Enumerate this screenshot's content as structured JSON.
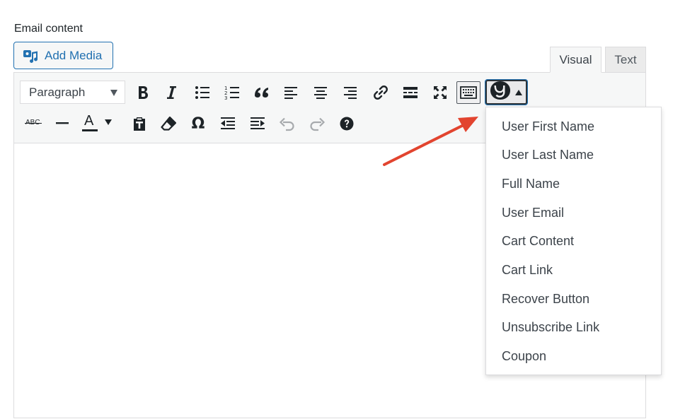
{
  "section": {
    "label": "Email content"
  },
  "media": {
    "add_label": "Add Media"
  },
  "tabs": {
    "visual": "Visual",
    "text": "Text"
  },
  "toolbar": {
    "format_value": "Paragraph",
    "row1_icons": [
      "bold-icon",
      "italic-icon",
      "bulleted-list-icon",
      "numbered-list-icon",
      "blockquote-icon",
      "align-left-icon",
      "align-center-icon",
      "align-right-icon",
      "link-icon",
      "read-more-icon",
      "fullscreen-icon",
      "toolbar-toggle-icon"
    ],
    "row2_icons": [
      "strikethrough-icon",
      "horizontal-line-icon",
      "text-color-icon",
      "paste-as-text-icon",
      "clear-formatting-icon",
      "special-character-icon",
      "outdent-icon",
      "indent-icon",
      "undo-icon",
      "redo-icon",
      "help-icon"
    ],
    "strike_text": "ABC",
    "text_color_letter": "A",
    "special_char": "Ω"
  },
  "shortcodes_menu": {
    "items": [
      "User First Name",
      "User Last Name",
      "Full Name",
      "User Email",
      "Cart Content",
      "Cart Link",
      "Recover Button",
      "Unsubscribe Link",
      "Coupon"
    ]
  },
  "colors": {
    "accent": "#2271b1",
    "annotation_arrow": "#e2442f",
    "toolbar_bg": "#f6f7f7"
  }
}
